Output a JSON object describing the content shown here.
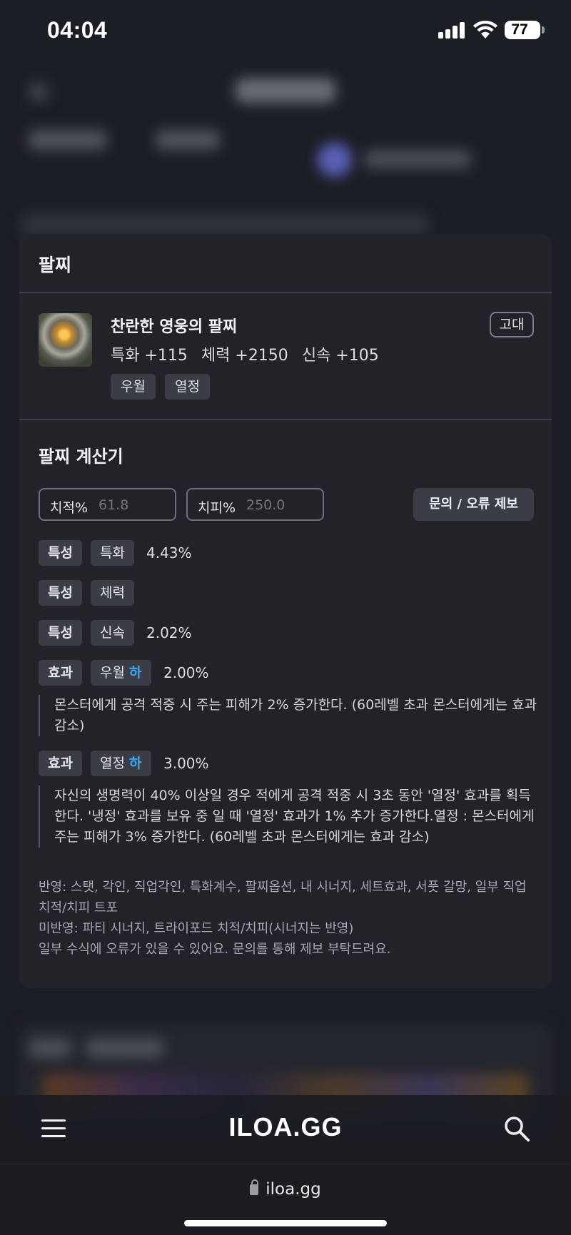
{
  "status_bar": {
    "time": "04:04",
    "battery": "77"
  },
  "card": {
    "title": "팔찌",
    "item": {
      "name": "찬란한 영웅의 팔찌",
      "grade": "고대",
      "stats": [
        "특화 +115",
        "체력 +2150",
        "신속 +105"
      ],
      "tags": [
        "우월",
        "열정"
      ]
    }
  },
  "calculator": {
    "title": "팔찌 계산기",
    "crit_rate": {
      "label": "치적%",
      "value": "61.8"
    },
    "crit_damage": {
      "label": "치피%",
      "value": "250.0"
    },
    "report_button": "문의 / 오류 제보",
    "rows": [
      {
        "type": "특성",
        "name": "특화",
        "value": "4.43%"
      },
      {
        "type": "특성",
        "name": "체력",
        "value": ""
      },
      {
        "type": "특성",
        "name": "신속",
        "value": "2.02%"
      },
      {
        "type": "효과",
        "name": "우월",
        "grade": "하",
        "value": "2.00%",
        "description": "몬스터에게 공격 적중 시 주는 피해가 2% 증가한다. (60레벨 초과 몬스터에게는 효과 감소)"
      },
      {
        "type": "효과",
        "name": "열정",
        "grade": "하",
        "value": "3.00%",
        "description": "자신의 생명력이 40% 이상일 경우 적에게 공격 적중 시 3초 동안 '열정' 효과를 획득한다. '냉정' 효과를 보유 중 일 때 '열정' 효과가 1% 추가 증가한다.열정 : 몬스터에게 주는 피해가 3% 증가한다. (60레벨 초과 몬스터에게는 효과 감소)"
      }
    ],
    "notes": [
      "반영: 스탯, 각인, 직업각인, 특화계수, 팔찌옵션, 내 시너지, 세트효과, 서풋 갈망, 일부 직업 치적/치피 트포",
      "미반영: 파티 시너지, 트라이포드 치적/치피(시너지는 반영)",
      "일부 수식에 오류가 있을 수 있어요. 문의를 통해 제보 부탁드려요."
    ]
  },
  "app_nav": {
    "logo": "ILOA.GG"
  },
  "browser": {
    "url": "iloa.gg"
  },
  "colors": {
    "grade_low": "#3aa9f5",
    "card_bg": "#212329",
    "page_bg": "#1b1d24"
  }
}
